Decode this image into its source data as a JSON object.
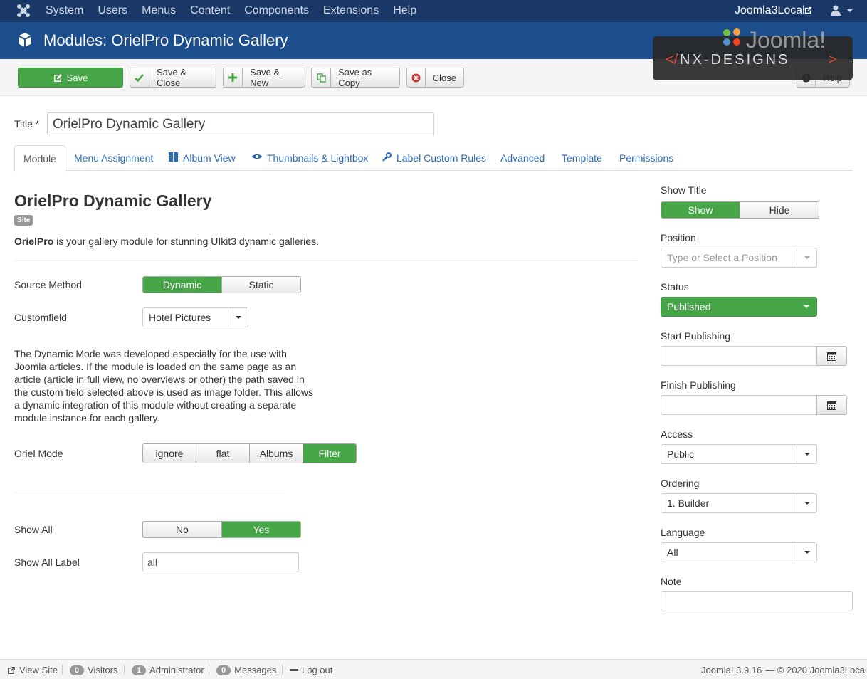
{
  "topnav": {
    "menu": [
      "System",
      "Users",
      "Menus",
      "Content",
      "Components",
      "Extensions",
      "Help"
    ],
    "site_name": "Joomla3Local"
  },
  "header": {
    "title": "Modules: OrielPro Dynamic Gallery"
  },
  "brand": {
    "logo_text": "NX-DESIGNS",
    "joomla_text": "Joomla!"
  },
  "toolbar": {
    "save": "Save",
    "save_close": "Save & Close",
    "save_new": "Save & New",
    "save_copy": "Save as Copy",
    "close": "Close",
    "help": "Help"
  },
  "title_field": {
    "label": "Title *",
    "value": "OrielPro Dynamic Gallery"
  },
  "tabs": [
    "Module",
    "Menu Assignment",
    "Album View",
    "Thumbnails & Lightbox",
    "Label Custom Rules",
    "Advanced",
    "Template",
    "Permissions"
  ],
  "module": {
    "heading": "OrielPro Dynamic Gallery",
    "badge": "Site",
    "desc_bold": "OrielPro",
    "desc_rest": " is your gallery module for stunning UIkit3 dynamic galleries."
  },
  "fields": {
    "source_method": {
      "label": "Source Method",
      "options": [
        "Dynamic",
        "Static"
      ],
      "selected": "Dynamic"
    },
    "customfield": {
      "label": "Customfield",
      "value": "Hotel Pictures"
    },
    "dynamic_note": "The Dynamic Mode was developed especially for the use with Joomla articles. If the module is loaded on the same page as an article (article in full view, no overviews or other) the path saved in the custom field selected above is used as image folder. This allows a dynamic integration of this module without creating a separate module instance for each gallery.",
    "oriel_mode": {
      "label": "Oriel Mode",
      "options": [
        "ignore",
        "flat",
        "Albums",
        "Filter"
      ],
      "selected": "Filter"
    },
    "show_all": {
      "label": "Show All",
      "options": [
        "No",
        "Yes"
      ],
      "selected": "Yes"
    },
    "show_all_label": {
      "label": "Show All Label",
      "value": "all"
    }
  },
  "sidebar": {
    "show_title": {
      "label": "Show Title",
      "options": [
        "Show",
        "Hide"
      ],
      "selected": "Show"
    },
    "position": {
      "label": "Position",
      "placeholder": "Type or Select a Position"
    },
    "status": {
      "label": "Status",
      "value": "Published",
      "color": "#46a546"
    },
    "start_publishing": {
      "label": "Start Publishing"
    },
    "finish_publishing": {
      "label": "Finish Publishing"
    },
    "access": {
      "label": "Access",
      "value": "Public"
    },
    "ordering": {
      "label": "Ordering",
      "value": "1. Builder"
    },
    "language": {
      "label": "Language",
      "value": "All"
    },
    "note": {
      "label": "Note"
    }
  },
  "footer": {
    "view_site": "View Site",
    "visitors_count": "0",
    "visitors": "Visitors",
    "admin_count": "1",
    "admin": "Administrator",
    "messages_count": "0",
    "messages": "Messages",
    "logout": "Log out",
    "version": "Joomla! 3.9.16",
    "copyright": "— © 2020 Joomla3Local"
  }
}
